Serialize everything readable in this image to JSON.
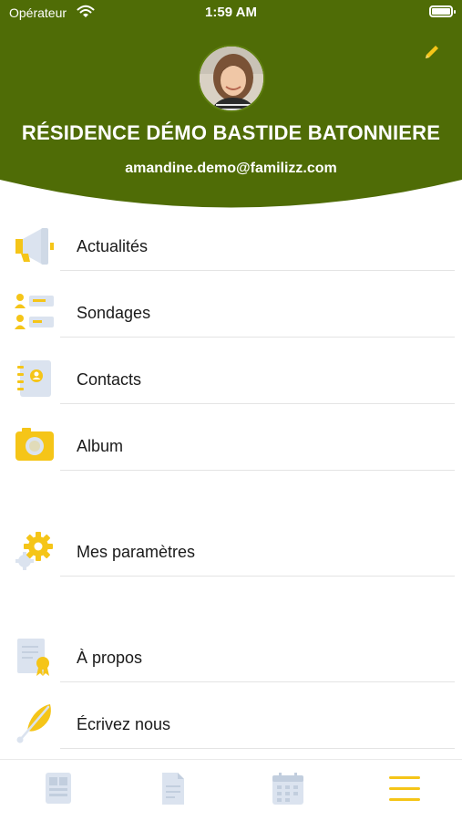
{
  "status_bar": {
    "carrier": "Opérateur",
    "time": "1:59 AM"
  },
  "header": {
    "residence_name": "RÉSIDENCE DÉMO BASTIDE BATONNIERE",
    "email": "amandine.demo@familizz.com",
    "background_color": "#4f6c06",
    "accent_color": "#f5c518"
  },
  "menu": {
    "news": {
      "label": "Actualités",
      "icon": "megaphone-icon"
    },
    "polls": {
      "label": "Sondages",
      "icon": "poll-list-icon"
    },
    "contacts": {
      "label": "Contacts",
      "icon": "address-book-icon"
    },
    "album": {
      "label": "Album",
      "icon": "camera-icon"
    },
    "settings": {
      "label": "Mes paramètres",
      "icon": "gear-icon"
    },
    "about": {
      "label": "À propos",
      "icon": "certificate-icon"
    },
    "write_us": {
      "label": "Écrivez nous",
      "icon": "feather-pen-icon"
    }
  },
  "tab_bar": {
    "tabs": [
      {
        "icon": "dashboard-icon",
        "active": false
      },
      {
        "icon": "document-icon",
        "active": false
      },
      {
        "icon": "calendar-icon",
        "active": false
      },
      {
        "icon": "menu-icon",
        "active": true
      }
    ]
  }
}
